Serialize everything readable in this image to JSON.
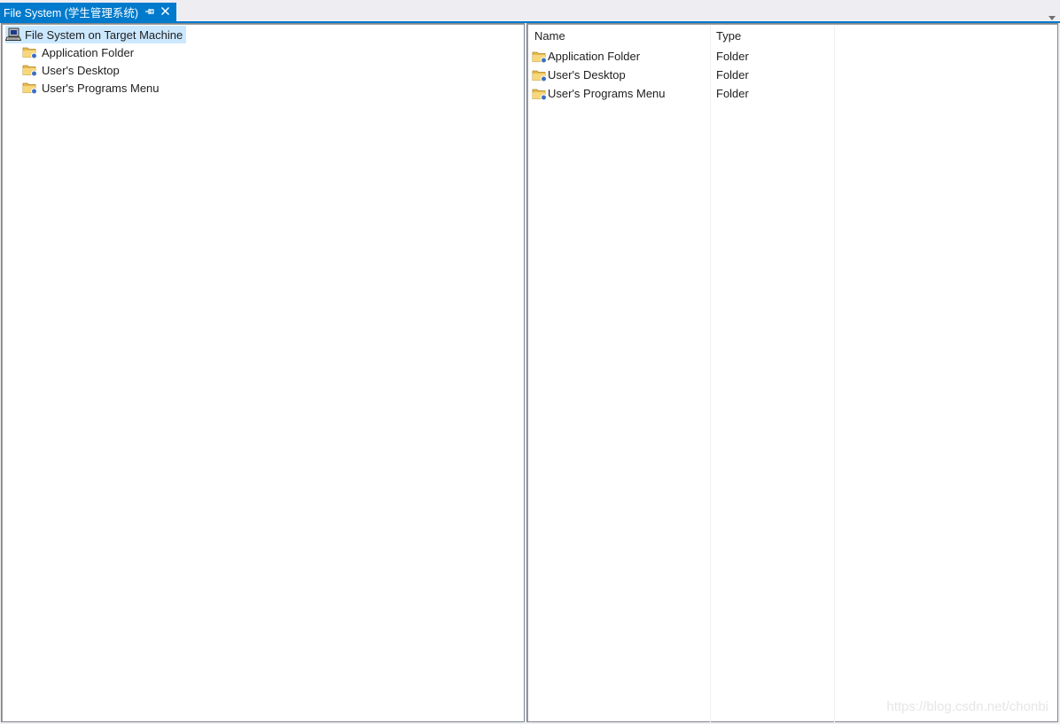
{
  "tab": {
    "title": "File System (学生管理系统)",
    "pin_icon": "pin-icon",
    "close_icon": "close-icon"
  },
  "tabstrip": {
    "dropdown_icon": "chevron-down-icon"
  },
  "tree": {
    "root": {
      "label": "File System on Target Machine",
      "icon": "computer-icon",
      "selected": true
    },
    "children": [
      {
        "label": "Application Folder",
        "icon": "special-folder-icon"
      },
      {
        "label": "User's Desktop",
        "icon": "special-folder-icon"
      },
      {
        "label": "User's Programs Menu",
        "icon": "special-folder-icon"
      }
    ]
  },
  "list": {
    "columns": [
      "Name",
      "Type"
    ],
    "rows": [
      {
        "name": "Application Folder",
        "type": "Folder",
        "icon": "special-folder-icon"
      },
      {
        "name": "User's Desktop",
        "type": "Folder",
        "icon": "special-folder-icon"
      },
      {
        "name": "User's Programs Menu",
        "type": "Folder",
        "icon": "special-folder-icon"
      }
    ]
  },
  "watermark": "https://blog.csdn.net/chonbi",
  "colors": {
    "accent": "#007acc",
    "selection": "#cce8ff",
    "folder": "#f3c96a"
  }
}
